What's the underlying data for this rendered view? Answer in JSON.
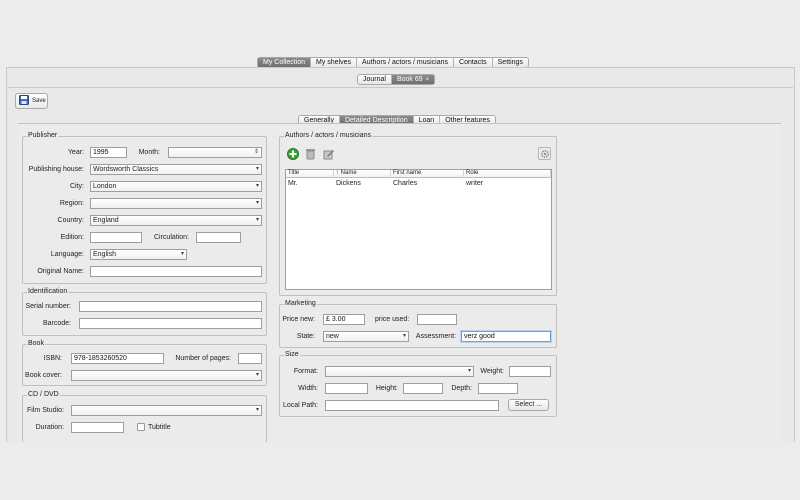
{
  "top_tabs": [
    {
      "label": "My Collection",
      "active": true
    },
    {
      "label": "My shelves",
      "active": false
    },
    {
      "label": "Authors / actors / musicians",
      "active": false
    },
    {
      "label": "Contacts",
      "active": false
    },
    {
      "label": "Settings",
      "active": false
    }
  ],
  "doc_tabs": [
    {
      "label": "Journal",
      "active": false
    },
    {
      "label": "Book 69",
      "active": true,
      "close": "×"
    }
  ],
  "toolbar": {
    "save_label": "Save"
  },
  "sub_tabs": [
    {
      "label": "Generally",
      "active": false
    },
    {
      "label": "Detailed Description",
      "active": true
    },
    {
      "label": "Loan",
      "active": false
    },
    {
      "label": "Other features",
      "active": false
    }
  ],
  "publisher": {
    "legend": "Publisher",
    "year_label": "Year:",
    "year_value": "1995",
    "month_label": "Month:",
    "month_value": "",
    "house_label": "Publishing house:",
    "house_value": "Wordsworth Classics",
    "city_label": "City:",
    "city_value": "London",
    "region_label": "Region:",
    "region_value": "",
    "country_label": "Country:",
    "country_value": "England",
    "edition_label": "Edition:",
    "edition_value": "",
    "circulation_label": "Circulation:",
    "circulation_value": "",
    "language_label": "Language:",
    "language_value": "English",
    "original_name_label": "Original Name:",
    "original_name_value": ""
  },
  "identification": {
    "legend": "Identification",
    "serial_label": "Serial number:",
    "serial_value": "",
    "barcode_label": "Barcode:",
    "barcode_value": ""
  },
  "book": {
    "legend": "Book",
    "isbn_label": "ISBN:",
    "isbn_value": "978-1853260520",
    "pages_label": "Number of pages:",
    "pages_value": "",
    "cover_label": "Book cover:",
    "cover_value": ""
  },
  "cd_dvd": {
    "legend": "CD / DVD",
    "studio_label": "Film Studio:",
    "studio_value": "",
    "duration_label": "Duration:",
    "duration_value": "",
    "tubtitle_label": "Tubtitle"
  },
  "authors": {
    "legend": "Authors / actors / musicians",
    "columns": [
      "Title",
      "↑ Name",
      "First name",
      "Role"
    ],
    "rows": [
      {
        "title": "Mr.",
        "name": "Dickens",
        "first_name": "Charles",
        "role": "writer"
      }
    ]
  },
  "marketing": {
    "legend": "Marketing",
    "price_new_label": "Price new:",
    "price_new_value": "£ 3.00",
    "price_used_label": "price used:",
    "price_used_value": "",
    "state_label": "State:",
    "state_value": "new",
    "assessment_label": "Assessment:",
    "assessment_value": "verz good"
  },
  "size": {
    "legend": "Size",
    "format_label": "Format:",
    "format_value": "",
    "weight_label": "Weight:",
    "weight_value": "",
    "width_label": "Width:",
    "width_value": "",
    "height_label": "Height:",
    "height_value": "",
    "depth_label": "Depth:",
    "depth_value": "",
    "local_path_label": "Local Path:",
    "local_path_value": "",
    "select_label": "Select ..."
  },
  "colors": {
    "active_tab": "#7a7a7a",
    "focus": "#6d9ed6",
    "add_icon": "#3aa13a"
  }
}
